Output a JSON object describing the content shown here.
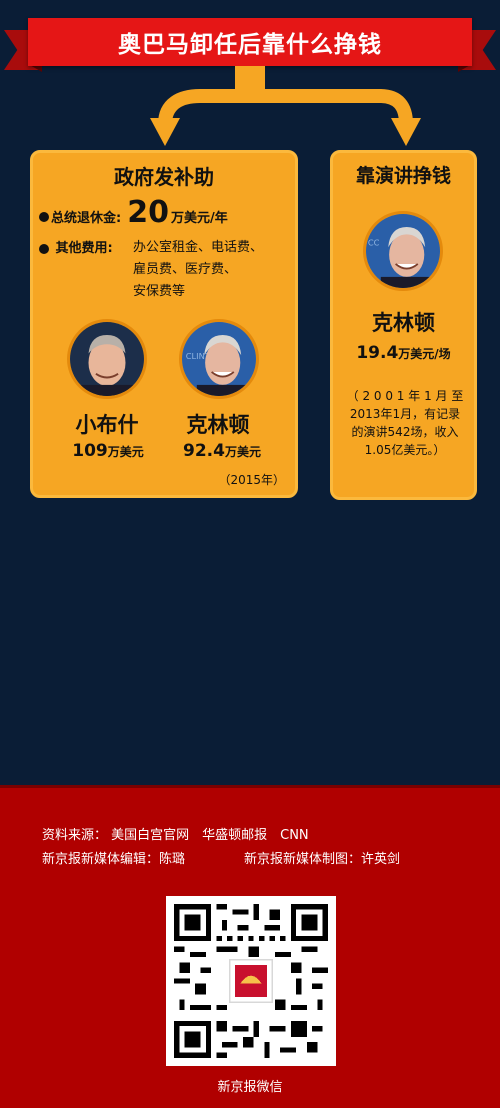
{
  "title": "奥巴马卸任后靠什么挣钱",
  "left_card": {
    "heading": "政府发补助",
    "pension_label": "总统退休金:",
    "pension_value": "20",
    "pension_unit": "万美元/年",
    "other_label": "其他费用:",
    "other_line1": "办公室租金、电话费、",
    "other_line2": "雇员费、医疗费、",
    "other_line3": "安保费等",
    "person1_name": "小布什",
    "person1_amount": "109",
    "person1_unit": "万美元",
    "person2_name": "克林顿",
    "person2_amount": "92.4",
    "person2_unit": "万美元",
    "year_note": "（2015年）"
  },
  "right_card": {
    "heading": "靠演讲挣钱",
    "person_name": "克林顿",
    "fee_amount": "19.4",
    "fee_unit": "万美元/场",
    "note_line1": "（ 2 0 0 1 年 1 月 至",
    "note_line2": "2013年1月，有记录",
    "note_line3": "的演讲542场，收入",
    "note_line4": "1.05亿美元。）"
  },
  "footer": {
    "source": "资料来源： 美国白宫官网　华盛顿邮报　CNN",
    "editor": "新京报新媒体编辑：陈璐",
    "designer": "新京报新媒体制图：许英剑",
    "qr_logo_text": "新京报",
    "qr_caption": "新京报微信"
  },
  "colors": {
    "background": "#0a1d36",
    "title_red": "#e51616",
    "card_orange": "#f6a623",
    "footer_red": "#b00000"
  },
  "icons": [
    "portrait-bush",
    "portrait-clinton",
    "qr-code",
    "curved-arrow"
  ]
}
